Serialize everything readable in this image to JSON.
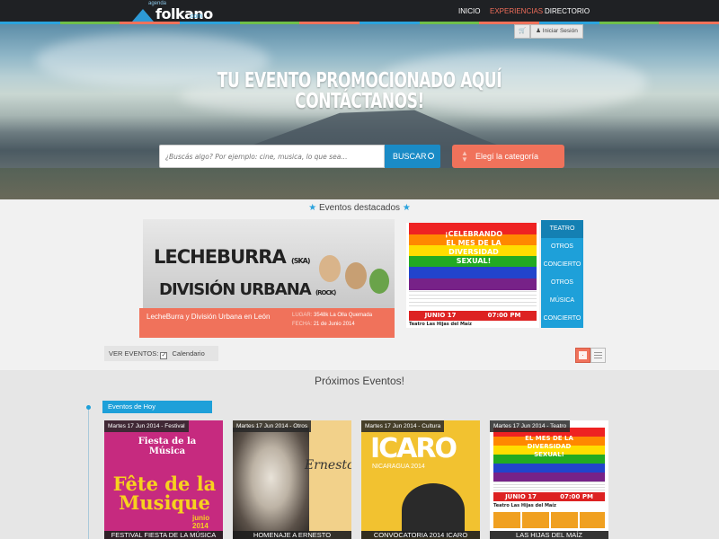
{
  "header": {
    "logo_prefix": "agenda",
    "logo_text": "folkano",
    "logo_suffix": ".com",
    "nav": [
      {
        "label": "INICIO"
      },
      {
        "label": "EXPERIENCIAS"
      },
      {
        "label": "DIRECTORIO"
      }
    ],
    "login_label": "Iniciar Sesión"
  },
  "hero": {
    "title_line1": "TU EVENTO PROMOCIONADO AQUÍ",
    "title_line2": "CONTÁCTANOS!",
    "search_placeholder": "¿Buscás algo? Por ejemplo: cine, musica, lo que sea...",
    "search_button": "BUSCAR",
    "category_button": "Elegí la categoría"
  },
  "featured": {
    "heading": "Eventos destacados",
    "main": {
      "poster_line1": "LECHEBURRA",
      "poster_line1_tag": "(SKA)",
      "poster_line2": "DIVISIÓN URBANA",
      "poster_line2_tag": "(ROCK)",
      "title": "LecheBurra y División Urbana en León",
      "place_label": "LUGAR:",
      "place": "3548k La Olla Quemada",
      "date_label": "FECHA:",
      "date": "21 de Junio 2014"
    },
    "side": {
      "poster_title": "¡CELEBRANDO EL MES DE LA DIVERSIDAD SEXUAL!",
      "date": "JUNIO 17",
      "time": "07:00 PM",
      "venue": "Teatro Las Hijas del Maíz"
    },
    "tags": [
      "TEATRO",
      "OTROS",
      "CONCIERTO",
      "OTROS",
      "MÚSICA",
      "CONCIERTO"
    ]
  },
  "view": {
    "label": "VER EVENTOS:",
    "calendar_label": "Calendario",
    "calendar_checked": true
  },
  "upcoming": {
    "heading": "Próximos Eventos!",
    "today_tab": "Eventos de Hoy",
    "cards": [
      {
        "date": "Martes 17 Jun 2014 - Festival",
        "name": "FESTIVAL FIESTA DE LA MÚSICA",
        "poster_top": "Fiesta de la Música",
        "poster_main": "Fête de la Musique",
        "poster_sub": "junio 2014"
      },
      {
        "date": "Martes 17 Jun 2014 - Otros",
        "name": "HOMENAJE A ERNESTO",
        "poster_main": "Ernesto"
      },
      {
        "date": "Martes 17 Jun 2014 - Cultura",
        "name": "CONVOCATORIA 2014 ICARO",
        "poster_main": "ICARO",
        "poster_sub": "NICARAGUA 2014"
      },
      {
        "date": "Martes 17 Jun 2014 - Teatro",
        "name": "LAS HIJAS DEL MAÍZ",
        "poster_main": "EL MES DE LA DIVERSIDAD SEXUAL!",
        "poster_date": "JUNIO 17",
        "poster_time": "07:00 PM",
        "poster_venue": "Teatro Las Hijas del Maíz"
      }
    ]
  },
  "colors": {
    "accent": "#f0725b",
    "brand_blue": "#1ea0d9",
    "topbar": "#1f2124"
  }
}
